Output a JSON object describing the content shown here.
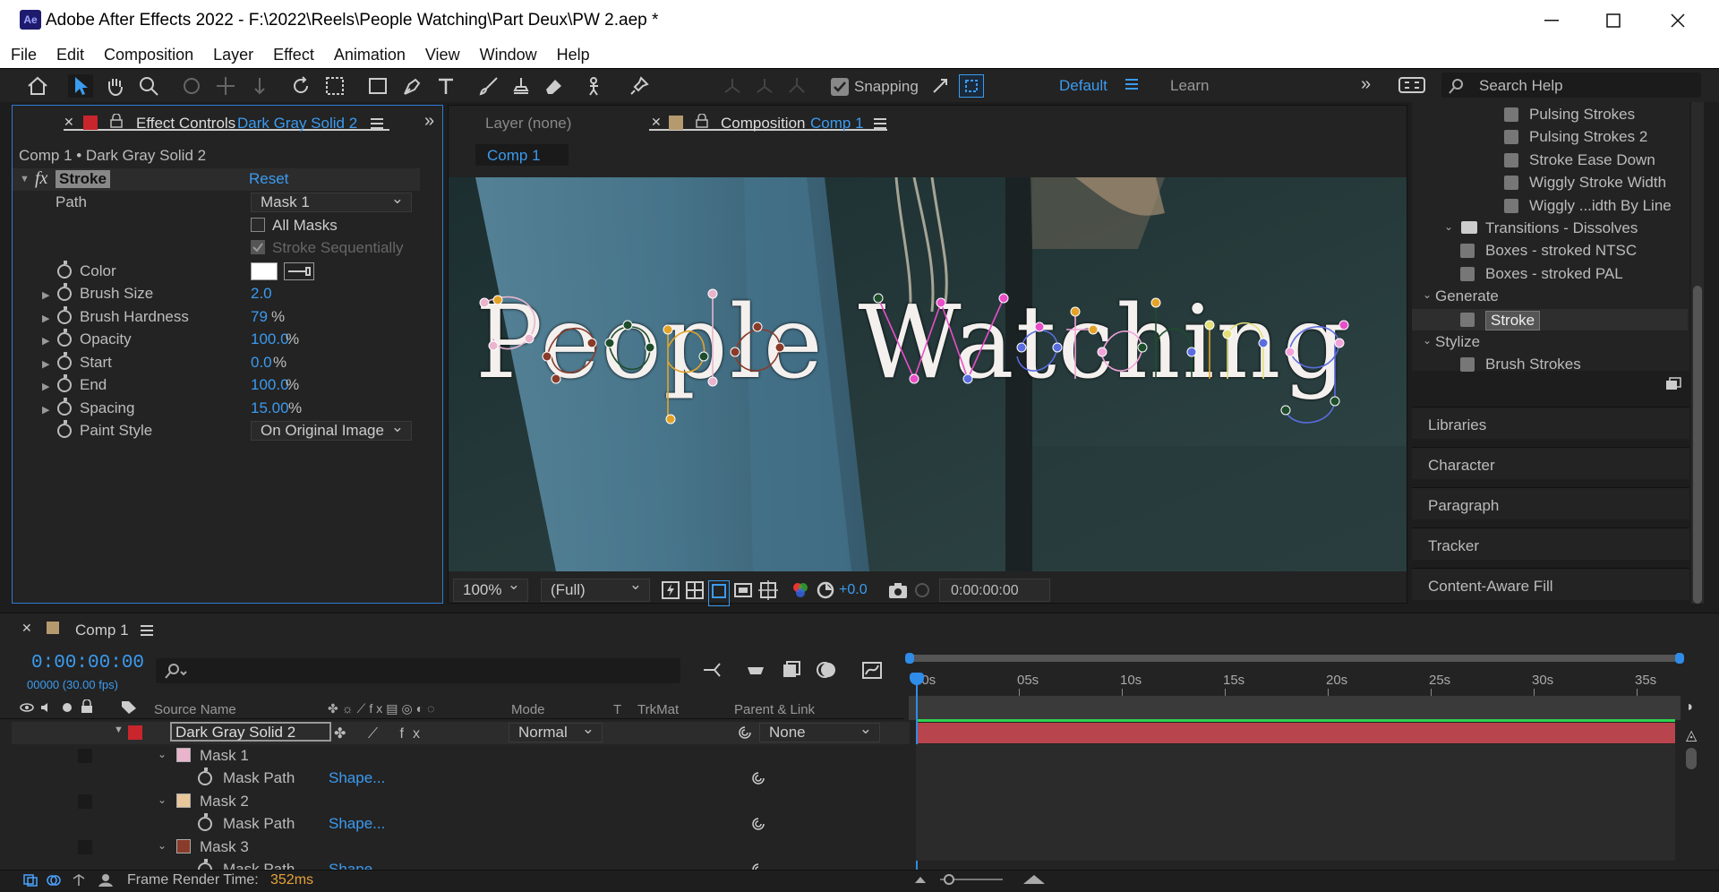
{
  "window": {
    "app_icon": "Ae",
    "title": "Adobe After Effects 2022 - F:\\2022\\Reels\\People Watching\\Part Deux\\PW 2.aep *"
  },
  "menu": [
    "File",
    "Edit",
    "Composition",
    "Layer",
    "Effect",
    "Animation",
    "View",
    "Window",
    "Help"
  ],
  "toolbar": {
    "snapping": "Snapping",
    "workspace": "Default",
    "learn": "Learn",
    "search_placeholder": "Search Help"
  },
  "effect_controls": {
    "tab_label": "Effect Controls",
    "tab_layer": "Dark Gray Solid 2",
    "breadcrumb": "Comp 1 • Dark Gray Solid 2",
    "effect_name": "Stroke",
    "reset": "Reset",
    "fx": "fx",
    "path_label": "Path",
    "path_value": "Mask 1",
    "all_masks": "All Masks",
    "stroke_seq": "Stroke Sequentially",
    "color_label": "Color",
    "props": [
      {
        "label": "Brush Size",
        "value": "2.0",
        "unit": ""
      },
      {
        "label": "Brush Hardness",
        "value": "79",
        "unit": "%"
      },
      {
        "label": "Opacity",
        "value": "100.0",
        "unit": "%"
      },
      {
        "label": "Start",
        "value": "0.0",
        "unit": "%"
      },
      {
        "label": "End",
        "value": "100.0",
        "unit": "%"
      },
      {
        "label": "Spacing",
        "value": "15.00",
        "unit": "%"
      }
    ],
    "paint_style_label": "Paint Style",
    "paint_style_value": "On Original Image"
  },
  "viewer": {
    "layer_tab": "Layer  (none)",
    "comp_tab": "Composition",
    "comp_name": "Comp 1",
    "subtab": "Comp 1",
    "overlay_text": "People Watching",
    "zoom": "100%",
    "resolution": "(Full)",
    "exposure": "+0.0",
    "timecode": "0:00:00:00"
  },
  "effects_presets": {
    "items": [
      {
        "label": "Pulsing Strokes",
        "indent": 2
      },
      {
        "label": "Pulsing Strokes 2",
        "indent": 2
      },
      {
        "label": "Stroke Ease Down",
        "indent": 2
      },
      {
        "label": "Wiggly Stroke Width",
        "indent": 2
      },
      {
        "label": "Wiggly ...idth By Line",
        "indent": 2
      },
      {
        "label": "Transitions - Dissolves",
        "indent": 1,
        "folder": true
      },
      {
        "label": "Boxes - stroked NTSC",
        "indent": 1
      },
      {
        "label": "Boxes - stroked PAL",
        "indent": 1
      },
      {
        "label": "Generate",
        "indent": 0,
        "group": true
      },
      {
        "label": "Stroke",
        "indent": 1,
        "selected": true
      },
      {
        "label": "Stylize",
        "indent": 0,
        "group": true
      },
      {
        "label": "Brush Strokes",
        "indent": 1
      }
    ]
  },
  "right_panels": [
    "Libraries",
    "Character",
    "Paragraph",
    "Tracker",
    "Content-Aware Fill"
  ],
  "timeline": {
    "comp_tab": "Comp 1",
    "timecode": "0:00:00:00",
    "frames": "00000 (30.00 fps)",
    "columns": {
      "source": "Source Name",
      "mode": "Mode",
      "t": "T",
      "trkmat": "TrkMat",
      "parent": "Parent & Link"
    },
    "layer": {
      "name": "Dark Gray Solid 2",
      "mode": "Normal",
      "parent": "None"
    },
    "masks": [
      {
        "name": "Mask 1",
        "color": "#e9b4cc",
        "prop": "Mask Path",
        "value": "Shape..."
      },
      {
        "name": "Mask 2",
        "color": "#e8c79a",
        "prop": "Mask Path",
        "value": "Shape..."
      },
      {
        "name": "Mask 3",
        "color": "#8a3b2a",
        "prop": "Mask Path",
        "value": "Shape..."
      }
    ],
    "ruler": [
      "00s",
      "05s",
      "10s",
      "15s",
      "20s",
      "25s",
      "30s",
      "35s"
    ],
    "render_time_label": "Frame Render Time:",
    "render_time_value": "352ms"
  },
  "colors": {
    "accent": "#3b9bf0",
    "layer_bar": "#b8454d",
    "render_time": "#e5a23a"
  }
}
